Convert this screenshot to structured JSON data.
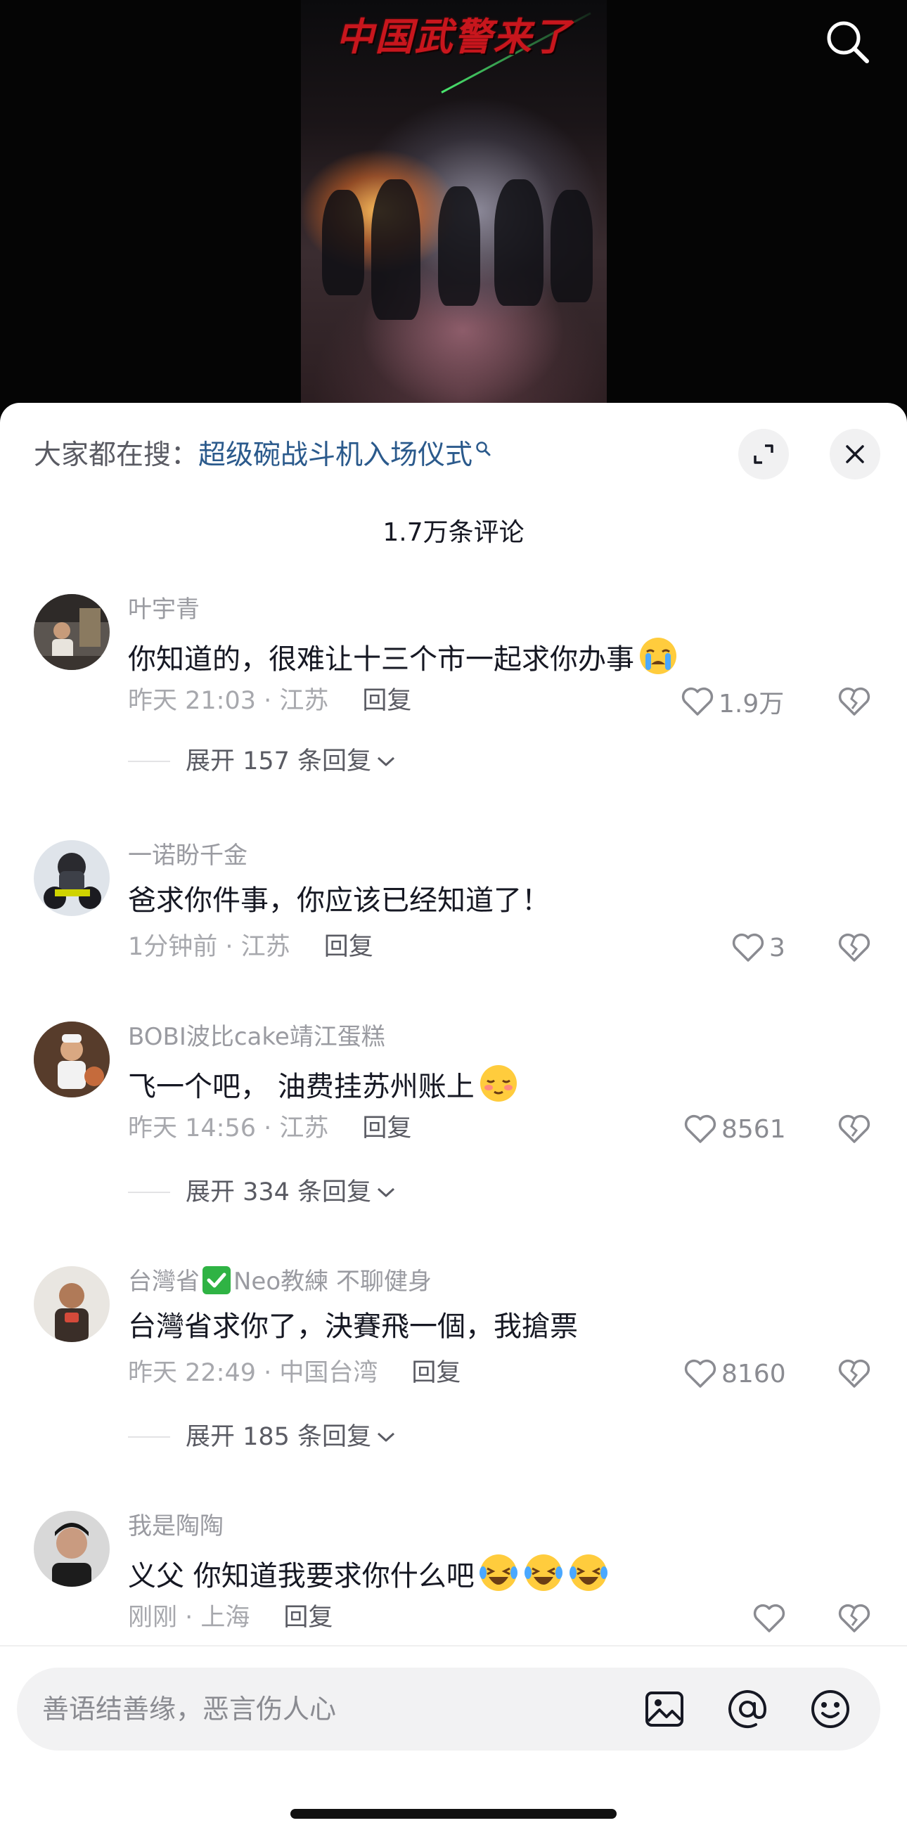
{
  "video": {
    "overlay_title": "中国武警来了"
  },
  "header": {
    "hot_search_prefix": "大家都在搜：",
    "hot_search_term": "超级碗战斗机入场仪式",
    "comment_count": "1.7万条评论"
  },
  "comments": [
    {
      "user": "叶宇青",
      "text": "你知道的，很难让十三个市一起求你办事",
      "emoji": "crying-face-icon",
      "time": "昨天 21:03",
      "location": "江苏",
      "reply_label": "回复",
      "likes": "1.9万",
      "expand_label": "展开 157 条回复"
    },
    {
      "user": "一诺盼千金",
      "text": "爸求你件事，你应该已经知道了！",
      "time": "1分钟前",
      "location": "江苏",
      "reply_label": "回复",
      "likes": "3"
    },
    {
      "user": "BOBI波比cake靖江蛋糕",
      "text": "飞一个吧， 油费挂苏州账上",
      "emoji": "smirk-face-icon",
      "time": "昨天 14:56",
      "location": "江苏",
      "reply_label": "回复",
      "likes": "8561",
      "expand_label": "展开 334 条回复"
    },
    {
      "user_prefix": "台灣省",
      "user_suffix": "Neo教練 不聊健身",
      "text": "台灣省求你了，決賽飛一個，我搶票",
      "time": "昨天 22:49",
      "location": "中国台湾",
      "reply_label": "回复",
      "likes": "8160",
      "expand_label": "展开 185 条回复"
    },
    {
      "user": "我是陶陶",
      "text": "义父 你知道我要求你什么吧",
      "emoji": "laughing-tears-icon",
      "time": "刚刚",
      "location": "上海",
      "reply_label": "回复",
      "likes": ""
    }
  ],
  "input": {
    "placeholder": "善语结善缘，恶言伤人心"
  },
  "colors": {
    "accent_link": "#2b5a8c",
    "meta_gray": "#a7a8ad",
    "text": "#161823"
  }
}
